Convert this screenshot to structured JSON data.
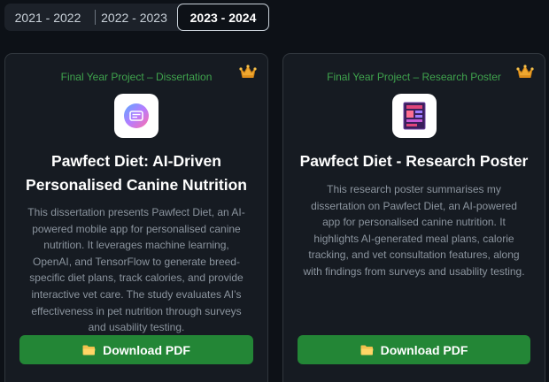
{
  "tabs": [
    {
      "label": "2021 - 2022"
    },
    {
      "label": "2022 - 2023"
    },
    {
      "label": "2023 - 2024",
      "active": true
    }
  ],
  "cards": [
    {
      "category": "Final Year Project – Dissertation",
      "icon": "app-logo-icon",
      "title": "Pawfect Diet: AI-Driven Personalised Canine Nutrition",
      "description": "This dissertation presents Pawfect Diet, an AI-powered mobile app for personalised canine nutrition. It leverages machine learning, OpenAI, and TensorFlow to generate breed-specific diet plans, track calories, and provide interactive vet care. The study evaluates AI’s effectiveness in pet nutrition through surveys and usability testing.",
      "button_label": "Download PDF"
    },
    {
      "category": "Final Year Project – Research Poster",
      "icon": "poster-icon",
      "title": "Pawfect Diet - Research Poster",
      "description": "This research poster summarises my dissertation on Pawfect Diet, an AI-powered app for personalised canine nutrition. It highlights AI-generated meal plans, calorie tracking, and vet consultation features, along with findings from surveys and usability testing.",
      "button_label": "Download PDF"
    }
  ],
  "colors": {
    "background": "#0d1117",
    "card": "#161b22",
    "accent_green": "#238636",
    "category_green": "#3fa34d",
    "crown": "#f0a830"
  }
}
